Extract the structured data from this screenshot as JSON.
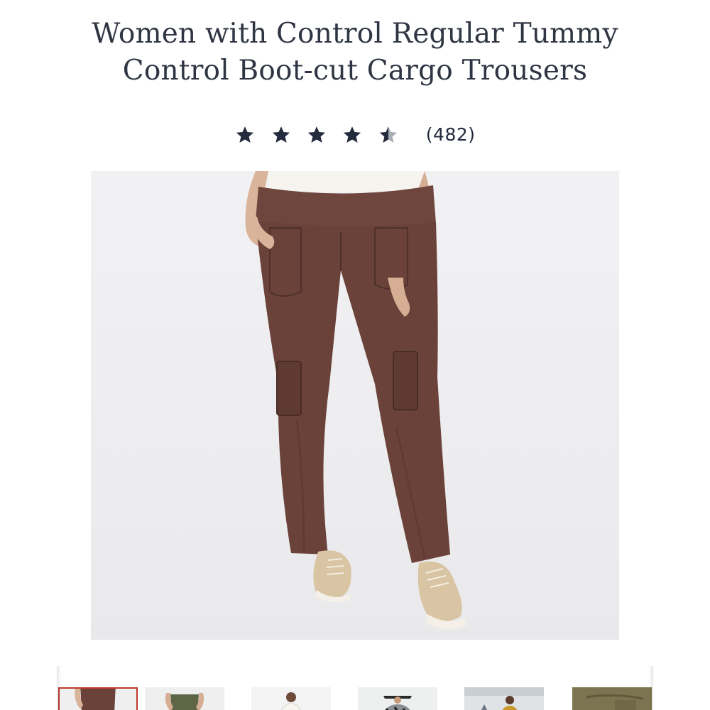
{
  "product": {
    "title": "Women with Control Regular Tummy Control Boot-cut Cargo Trousers",
    "rating": {
      "value": 4.5,
      "max": 5,
      "review_count": "(482)",
      "star_color": "#232b3d",
      "star_empty_color": "#a9adb6"
    },
    "main_image_icon": "product-photo-brown-cargo-trousers",
    "garment_color": "#6b4239"
  },
  "thumbnails": [
    {
      "icon": "thumb-brown-trousers",
      "selected": true
    },
    {
      "icon": "thumb-olive-trousers",
      "selected": false
    },
    {
      "icon": "thumb-model-white",
      "selected": false
    },
    {
      "icon": "thumb-model-pattern",
      "selected": false
    },
    {
      "icon": "thumb-model-group",
      "selected": false
    },
    {
      "icon": "thumb-olive-detail",
      "selected": false
    }
  ],
  "colors": {
    "title": "#2f3542",
    "selected_border": "#c0392b"
  }
}
